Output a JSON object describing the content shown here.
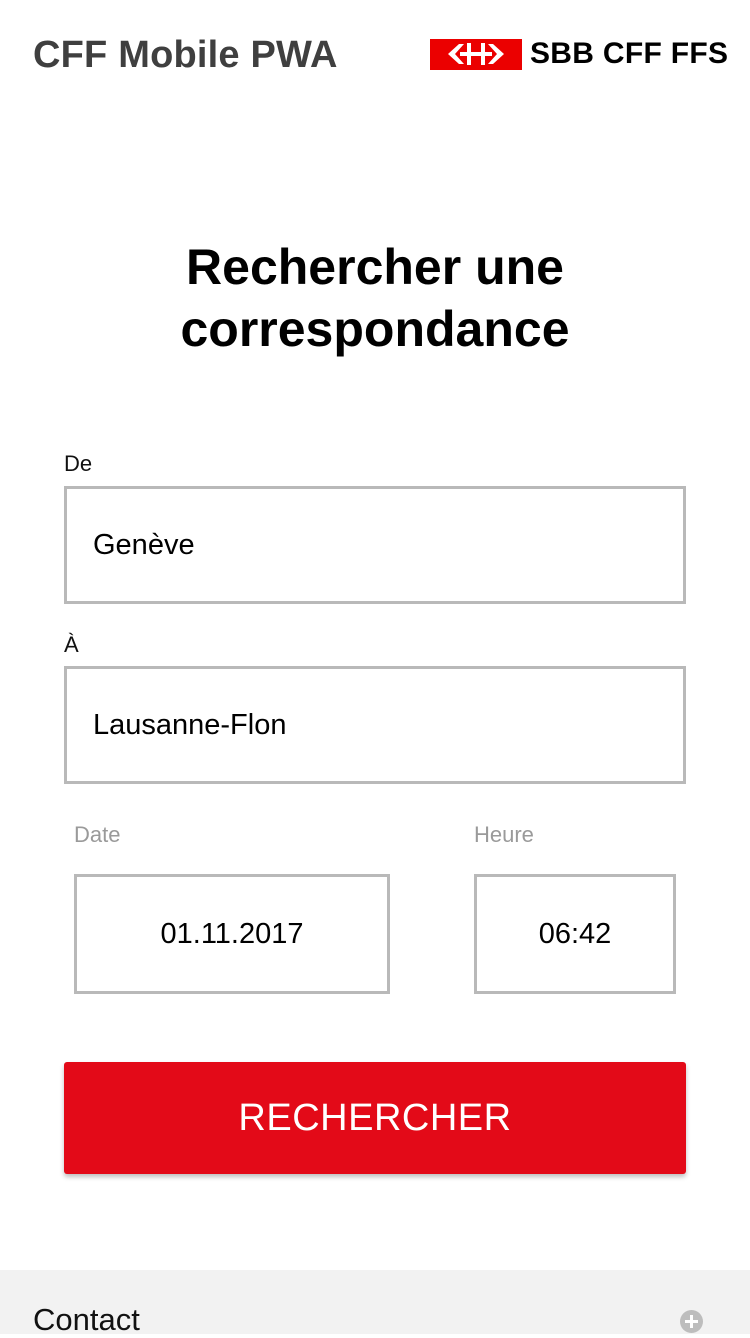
{
  "header": {
    "app_title": "CFF Mobile PWA",
    "logo_text": "SBB CFF FFS",
    "logo_icon": "sbb-arrows-icon",
    "brand_color": "#eb0000"
  },
  "main": {
    "title_line1": "Rechercher une",
    "title_line2": "correspondance",
    "from": {
      "label": "De",
      "value": "Genève"
    },
    "to": {
      "label": "À",
      "value": "Lausanne-Flon"
    },
    "date": {
      "label": "Date",
      "value": "01.11.2017"
    },
    "time": {
      "label": "Heure",
      "value": "06:42"
    },
    "search_button_label": "RECHERCHER",
    "search_button_color": "#e30a18"
  },
  "footer": {
    "contact_label": "Contact",
    "expand_icon": "plus-circle-icon"
  }
}
